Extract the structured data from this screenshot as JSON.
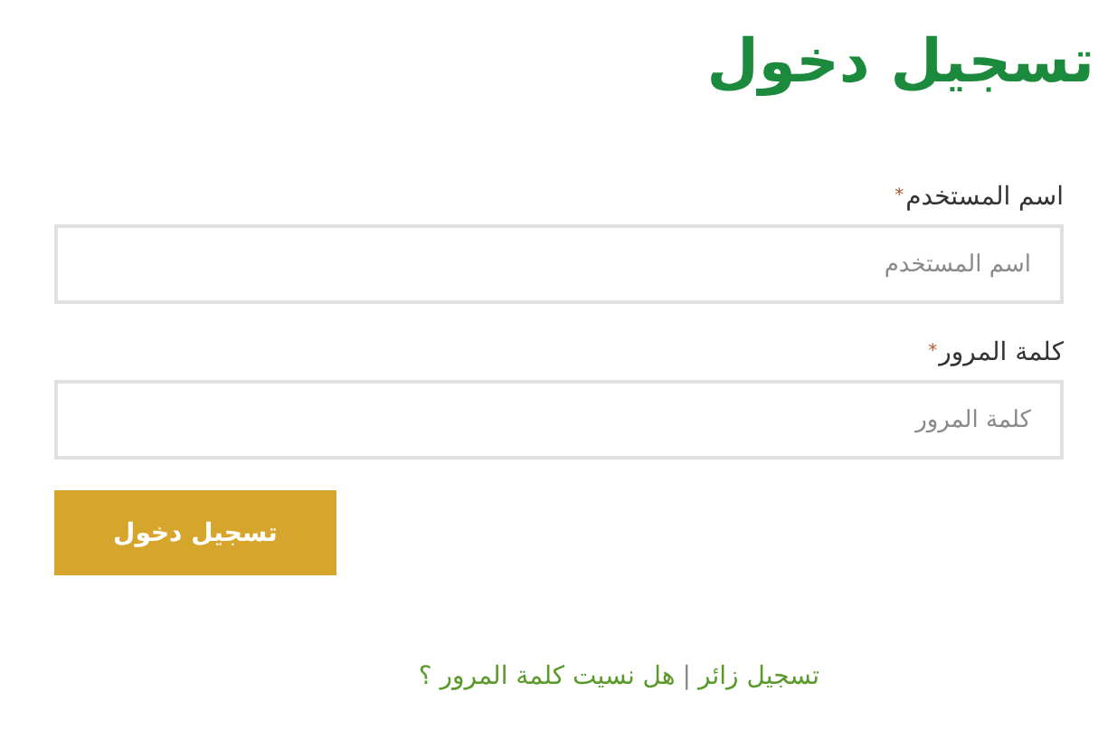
{
  "title": "تسجيل دخول",
  "fields": [
    {
      "label": "اسم المستخدم",
      "required_mark": "*",
      "placeholder": "اسم المستخدم"
    },
    {
      "label": "كلمة المرور",
      "required_mark": "*",
      "placeholder": "كلمة المرور"
    }
  ],
  "submit_button": "تسجيل دخول",
  "links": [
    {
      "text": "تسجيل زائر"
    },
    {
      "text": "هل نسيت كلمة المرور ؟"
    }
  ],
  "link_separator": "|"
}
